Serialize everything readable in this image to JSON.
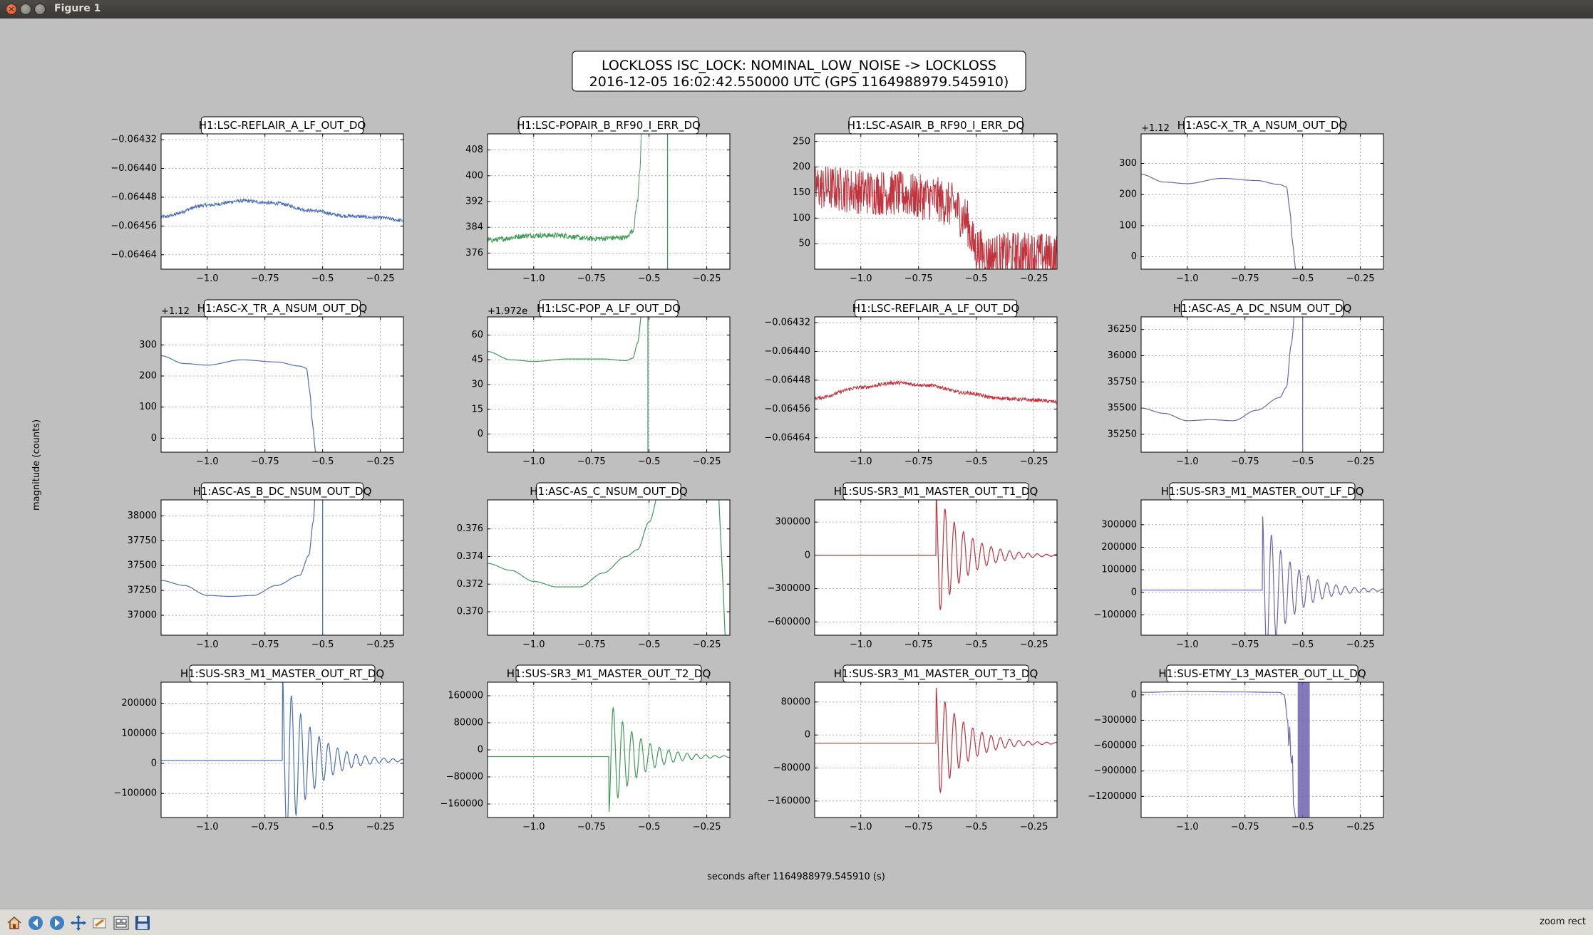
{
  "window": {
    "title": "Figure 1"
  },
  "figure": {
    "title_lines": [
      "LOCKLOSS ISC_LOCK: NOMINAL_LOW_NOISE -> LOCKLOSS",
      "2016-12-05 16:02:42.550000 UTC (GPS 1164988979.545910)"
    ],
    "ylabel": "magnitude (counts)",
    "xlabel": "seconds after 1164988979.545910 (s)"
  },
  "colors": {
    "blue": "#4b6fb5",
    "green": "#3e9b55",
    "red": "#c1343d",
    "purple": "#6f63b0"
  },
  "chart_data": [
    {
      "type": "line",
      "title": "H1:LSC-REFLAIR_A_LF_OUT_DQ",
      "color": "blue",
      "style": "noisy",
      "xlim": [
        -1.2,
        -0.15
      ],
      "ylim": [
        -0.06468,
        -0.064304
      ],
      "yticks": [
        -0.06432,
        -0.0644,
        -0.06448,
        -0.06456,
        -0.06464
      ],
      "yticklabels": [
        "−0.06432",
        "−0.06440",
        "−0.06448",
        "−0.06456",
        "−0.06464"
      ],
      "xticks": [
        -1.0,
        -0.75,
        -0.5,
        -0.25
      ],
      "xticklabels": [
        "−1.0",
        "−0.75",
        "−0.5",
        "−0.25"
      ],
      "offset_label": "",
      "x": [
        -1.2,
        -1.0,
        -0.85,
        -0.7,
        -0.55,
        -0.4,
        -0.25,
        -0.15
      ],
      "y": [
        -0.064535,
        -0.064502,
        -0.06449,
        -0.064497,
        -0.064517,
        -0.064532,
        -0.064537,
        -0.064545
      ],
      "noise": 5e-06
    },
    {
      "type": "line",
      "title": "H1:LSC-POPAIR_B_RF90_I_ERR_DQ",
      "color": "green",
      "style": "noisy",
      "xlim": [
        -1.2,
        -0.15
      ],
      "ylim": [
        371,
        413
      ],
      "yticks": [
        408,
        400,
        392,
        384,
        376
      ],
      "yticklabels": [
        "408",
        "400",
        "392",
        "384",
        "376"
      ],
      "xticks": [
        -1.0,
        -0.75,
        -0.5,
        -0.25
      ],
      "xticklabels": [
        "−1.0",
        "−0.75",
        "−0.5",
        "−0.25"
      ],
      "offset_label": "",
      "x": [
        -1.2,
        -1.0,
        -0.9,
        -0.75,
        -0.6,
        -0.57,
        -0.55,
        -0.54,
        -0.53
      ],
      "y": [
        380,
        381.5,
        381.5,
        380.5,
        380.8,
        383,
        392,
        402,
        420
      ],
      "noise": 0.8,
      "vlines": [
        -0.42
      ]
    },
    {
      "type": "line",
      "title": "H1:LSC-ASAIR_B_RF90_I_ERR_DQ",
      "color": "red",
      "style": "noisy",
      "xlim": [
        -1.2,
        -0.15
      ],
      "ylim": [
        0,
        265
      ],
      "yticks": [
        250,
        200,
        150,
        100,
        50
      ],
      "yticklabels": [
        "250",
        "200",
        "150",
        "100",
        "50"
      ],
      "xticks": [
        -1.0,
        -0.75,
        -0.5,
        -0.25
      ],
      "xticklabels": [
        "−1.0",
        "−0.75",
        "−0.5",
        "−0.25"
      ],
      "offset_label": "",
      "x": [
        -1.2,
        -0.9,
        -0.7,
        -0.6,
        -0.55,
        -0.5,
        -0.45,
        -0.3,
        -0.15
      ],
      "y": [
        160,
        150,
        140,
        125,
        100,
        40,
        25,
        30,
        25
      ],
      "noise": 45
    },
    {
      "type": "line",
      "title": "H1:ASC-X_TR_A_NSUM_OUT_DQ",
      "color": "purple",
      "style": "smooth",
      "xlim": [
        -1.2,
        -0.15
      ],
      "ylim": [
        -40,
        395
      ],
      "yticks": [
        300,
        200,
        100,
        0
      ],
      "yticklabels": [
        "300",
        "200",
        "100",
        "0"
      ],
      "xticks": [
        -1.0,
        -0.75,
        -0.5,
        -0.25
      ],
      "xticklabels": [
        "−1.0",
        "−0.75",
        "−0.5",
        "−0.25"
      ],
      "offset_label": "+1.12",
      "x": [
        -1.2,
        -1.1,
        -1.0,
        -0.85,
        -0.7,
        -0.6,
        -0.57,
        -0.555,
        -0.545,
        -0.53
      ],
      "y": [
        265,
        240,
        235,
        252,
        245,
        232,
        225,
        150,
        50,
        -40
      ]
    },
    {
      "type": "line",
      "title": "H1:ASC-X_TR_A_NSUM_OUT_DQ",
      "color": "blue",
      "style": "smooth",
      "xlim": [
        -1.2,
        -0.15
      ],
      "ylim": [
        -45,
        390
      ],
      "yticks": [
        300,
        200,
        100,
        0
      ],
      "yticklabels": [
        "300",
        "200",
        "100",
        "0"
      ],
      "xticks": [
        -1.0,
        -0.75,
        -0.5,
        -0.25
      ],
      "xticklabels": [
        "−1.0",
        "−0.75",
        "−0.5",
        "−0.25"
      ],
      "offset_label": "+1.12",
      "x": [
        -1.2,
        -1.1,
        -1.0,
        -0.85,
        -0.7,
        -0.6,
        -0.57,
        -0.555,
        -0.545,
        -0.53
      ],
      "y": [
        265,
        240,
        235,
        252,
        245,
        232,
        225,
        150,
        50,
        -45
      ]
    },
    {
      "type": "line",
      "title": "H1:LSC-POP_A_LF_OUT_DQ",
      "color": "green",
      "style": "smooth",
      "xlim": [
        -1.2,
        -0.15
      ],
      "ylim": [
        -11,
        71
      ],
      "yticks": [
        60,
        45,
        30,
        15,
        0
      ],
      "yticklabels": [
        "60",
        "45",
        "30",
        "15",
        "0"
      ],
      "xticks": [
        -1.0,
        -0.75,
        -0.5,
        -0.25
      ],
      "xticklabels": [
        "−1.0",
        "−0.75",
        "−0.5",
        "−0.25"
      ],
      "offset_label": "+1.972e",
      "x": [
        -1.2,
        -1.1,
        -1.0,
        -0.85,
        -0.7,
        -0.6,
        -0.57,
        -0.55,
        -0.53
      ],
      "y": [
        50,
        45,
        44,
        45.5,
        45.5,
        44.5,
        46,
        55,
        75
      ],
      "vlines": [
        -0.505
      ]
    },
    {
      "type": "line",
      "title": "H1:LSC-REFLAIR_A_LF_OUT_DQ",
      "color": "red",
      "style": "noisy",
      "xlim": [
        -1.2,
        -0.15
      ],
      "ylim": [
        -0.06468,
        -0.064304
      ],
      "yticks": [
        -0.06432,
        -0.0644,
        -0.06448,
        -0.06456,
        -0.06464
      ],
      "yticklabels": [
        "−0.06432",
        "−0.06440",
        "−0.06448",
        "−0.06456",
        "−0.06464"
      ],
      "xticks": [
        -1.0,
        -0.75,
        -0.5,
        -0.25
      ],
      "xticklabels": [
        "−1.0",
        "−0.75",
        "−0.5",
        "−0.25"
      ],
      "offset_label": "",
      "x": [
        -1.2,
        -1.0,
        -0.85,
        -0.7,
        -0.55,
        -0.4,
        -0.25,
        -0.15
      ],
      "y": [
        -0.06453,
        -0.0645,
        -0.064487,
        -0.064495,
        -0.064515,
        -0.06453,
        -0.064535,
        -0.06454
      ],
      "noise": 5e-06
    },
    {
      "type": "line",
      "title": "H1:ASC-AS_A_DC_NSUM_OUT_DQ",
      "color": "purple",
      "style": "smooth",
      "xlim": [
        -1.2,
        -0.15
      ],
      "ylim": [
        35080,
        36370
      ],
      "yticks": [
        36250,
        36000,
        35750,
        35500,
        35250
      ],
      "yticklabels": [
        "36250",
        "36000",
        "35750",
        "35500",
        "35250"
      ],
      "xticks": [
        -1.0,
        -0.75,
        -0.5,
        -0.25
      ],
      "xticklabels": [
        "−1.0",
        "−0.75",
        "−0.5",
        "−0.25"
      ],
      "offset_label": "",
      "x": [
        -1.2,
        -1.1,
        -1.0,
        -0.9,
        -0.8,
        -0.7,
        -0.6,
        -0.57,
        -0.55,
        -0.53
      ],
      "y": [
        35500,
        35450,
        35380,
        35390,
        35380,
        35480,
        35600,
        35700,
        36100,
        36500
      ],
      "vlines": [
        -0.5
      ]
    },
    {
      "type": "line",
      "title": "H1:ASC-AS_B_DC_NSUM_OUT_DQ",
      "color": "blue",
      "style": "smooth",
      "xlim": [
        -1.2,
        -0.15
      ],
      "ylim": [
        36800,
        38160
      ],
      "yticks": [
        38000,
        37750,
        37500,
        37250,
        37000
      ],
      "yticklabels": [
        "38000",
        "37750",
        "37500",
        "37250",
        "37000"
      ],
      "xticks": [
        -1.0,
        -0.75,
        -0.5,
        -0.25
      ],
      "xticklabels": [
        "−1.0",
        "−0.75",
        "−0.5",
        "−0.25"
      ],
      "offset_label": "",
      "x": [
        -1.2,
        -1.1,
        -1.0,
        -0.9,
        -0.8,
        -0.7,
        -0.6,
        -0.56,
        -0.54,
        -0.53
      ],
      "y": [
        37350,
        37300,
        37200,
        37190,
        37200,
        37300,
        37400,
        37600,
        37950,
        38300
      ],
      "vlines": [
        -0.5
      ]
    },
    {
      "type": "line",
      "title": "H1:ASC-AS_C_NSUM_OUT_DQ",
      "color": "green",
      "style": "smooth",
      "xlim": [
        -1.2,
        -0.15
      ],
      "ylim": [
        0.3683,
        0.3781
      ],
      "yticks": [
        0.376,
        0.374,
        0.372,
        0.37
      ],
      "yticklabels": [
        "0.376",
        "0.374",
        "0.372",
        "0.370"
      ],
      "xticks": [
        -1.0,
        -0.75,
        -0.5,
        -0.25
      ],
      "xticklabels": [
        "−1.0",
        "−0.75",
        "−0.5",
        "−0.25"
      ],
      "offset_label": "",
      "x": [
        -1.2,
        -1.1,
        -1.0,
        -0.9,
        -0.8,
        -0.7,
        -0.6,
        -0.55,
        -0.5,
        -0.45
      ],
      "y": [
        0.3735,
        0.373,
        0.3722,
        0.3718,
        0.3718,
        0.3728,
        0.374,
        0.3745,
        0.3765,
        0.379
      ],
      "extra_segment": {
        "x": [
          -0.2,
          -0.18,
          -0.17
        ],
        "y": [
          0.379,
          0.372,
          0.368
        ]
      }
    },
    {
      "type": "line",
      "title": "H1:SUS-SR3_M1_MASTER_OUT_T1_DQ",
      "color": "red",
      "style": "ringdown",
      "xlim": [
        -1.2,
        -0.15
      ],
      "ylim": [
        -720000,
        500000
      ],
      "yticks": [
        300000,
        0,
        -300000,
        -600000
      ],
      "yticklabels": [
        "300000",
        "0",
        "−300000",
        "−600000"
      ],
      "xticks": [
        -1.0,
        -0.75,
        -0.5,
        -0.25
      ],
      "xticklabels": [
        "−1.0",
        "−0.75",
        "−0.5",
        "−0.25"
      ],
      "offset_label": "",
      "baseline": 0,
      "t0": -0.675,
      "amp": 580000,
      "tau": 0.12,
      "period": 0.04
    },
    {
      "type": "line",
      "title": "H1:SUS-SR3_M1_MASTER_OUT_LF_DQ",
      "color": "purple",
      "style": "ringdown",
      "xlim": [
        -1.2,
        -0.15
      ],
      "ylim": [
        -190000,
        410000
      ],
      "yticks": [
        300000,
        200000,
        100000,
        0,
        -100000
      ],
      "yticklabels": [
        "300000",
        "200000",
        "100000",
        "0",
        "−100000"
      ],
      "xticks": [
        -1.0,
        -0.75,
        -0.5,
        -0.25
      ],
      "xticklabels": [
        "−1.0",
        "−0.75",
        "−0.5",
        "−0.25"
      ],
      "offset_label": "",
      "baseline": 10000,
      "t0": -0.675,
      "amp": 340000,
      "tau": 0.12,
      "period": 0.04
    },
    {
      "type": "line",
      "title": "H1:SUS-SR3_M1_MASTER_OUT_RT_DQ",
      "color": "blue",
      "style": "ringdown",
      "xlim": [
        -1.2,
        -0.15
      ],
      "ylim": [
        -180000,
        270000
      ],
      "yticks": [
        200000,
        100000,
        0,
        -100000
      ],
      "yticklabels": [
        "200000",
        "100000",
        "0",
        "−100000"
      ],
      "xticks": [
        -1.0,
        -0.75,
        -0.5,
        -0.25
      ],
      "xticklabels": [
        "−1.0",
        "−0.75",
        "−0.5",
        "−0.25"
      ],
      "offset_label": "",
      "baseline": 10000,
      "t0": -0.675,
      "amp": 300000,
      "tau": 0.12,
      "period": 0.04
    },
    {
      "type": "line",
      "title": "H1:SUS-SR3_M1_MASTER_OUT_T2_DQ",
      "color": "green",
      "style": "ringdown",
      "xlim": [
        -1.2,
        -0.15
      ],
      "ylim": [
        -200000,
        200000
      ],
      "yticks": [
        160000,
        80000,
        0,
        -80000,
        -160000
      ],
      "yticklabels": [
        "160000",
        "80000",
        "0",
        "−80000",
        "−160000"
      ],
      "xticks": [
        -1.0,
        -0.75,
        -0.5,
        -0.25
      ],
      "xticklabels": [
        "−1.0",
        "−0.75",
        "−0.5",
        "−0.25"
      ],
      "offset_label": "",
      "baseline": -20000,
      "t0": -0.675,
      "amp": -170000,
      "tau": 0.12,
      "period": 0.04
    },
    {
      "type": "line",
      "title": "H1:SUS-SR3_M1_MASTER_OUT_T3_DQ",
      "color": "red",
      "style": "ringdown",
      "xlim": [
        -1.2,
        -0.15
      ],
      "ylim": [
        -200000,
        128000
      ],
      "yticks": [
        80000,
        0,
        -80000,
        -160000
      ],
      "yticklabels": [
        "80000",
        "0",
        "−80000",
        "−160000"
      ],
      "xticks": [
        -1.0,
        -0.75,
        -0.5,
        -0.25
      ],
      "xticklabels": [
        "−1.0",
        "−0.75",
        "−0.5",
        "−0.25"
      ],
      "offset_label": "",
      "baseline": -20000,
      "t0": -0.675,
      "amp": 140000,
      "tau": 0.12,
      "period": 0.04
    },
    {
      "type": "line",
      "title": "H1:SUS-ETMY_L3_MASTER_OUT_LL_DQ",
      "color": "purple",
      "style": "smooth",
      "xlim": [
        -1.2,
        -0.15
      ],
      "ylim": [
        -1450000,
        150000
      ],
      "yticks": [
        0,
        -300000,
        -600000,
        -900000,
        -1200000
      ],
      "yticklabels": [
        "0",
        "−300000",
        "−600000",
        "−900000",
        "−1200000"
      ],
      "xticks": [
        -1.0,
        -0.75,
        -0.5,
        -0.25
      ],
      "xticklabels": [
        "−1.0",
        "−0.75",
        "−0.5",
        "−0.25"
      ],
      "offset_label": "",
      "x": [
        -1.2,
        -1.0,
        -0.8,
        -0.6,
        -0.58,
        -0.565,
        -0.56,
        -0.555,
        -0.55,
        -0.545,
        -0.54,
        -0.53
      ],
      "y": [
        30000,
        40000,
        35000,
        30000,
        0,
        -300000,
        -600000,
        -350000,
        -900000,
        -650000,
        -1300000,
        -1450000
      ],
      "burst": [
        -0.52,
        -0.47
      ]
    }
  ]
}
